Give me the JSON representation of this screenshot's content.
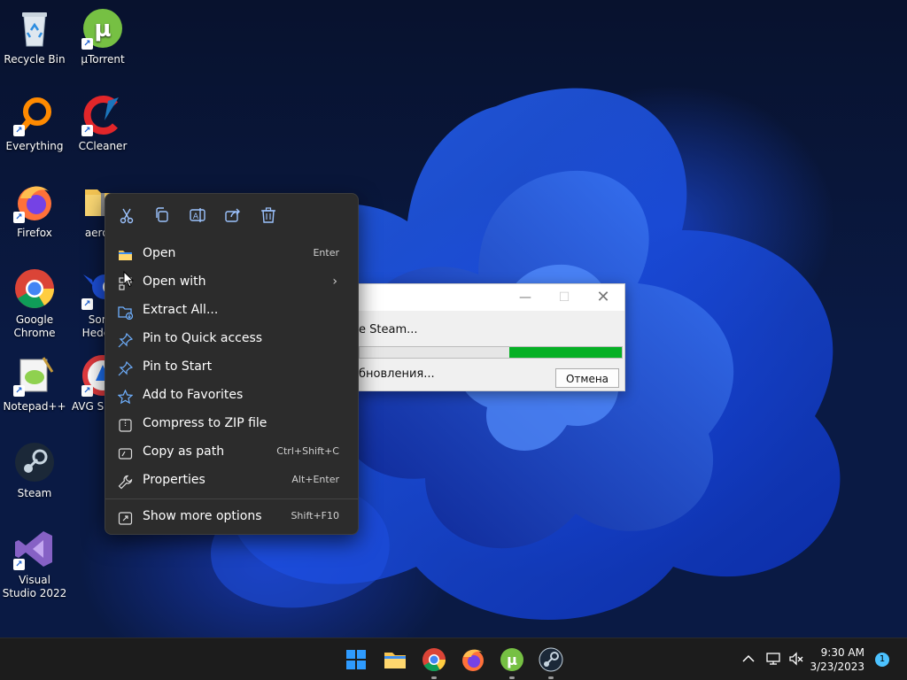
{
  "desktop": {
    "icons": [
      {
        "label": "Recycle Bin"
      },
      {
        "label": "µTorrent"
      },
      {
        "label": "Everything"
      },
      {
        "label": "CCleaner"
      },
      {
        "label": "Firefox"
      },
      {
        "label": "aero_h"
      },
      {
        "label": "Google Chrome"
      },
      {
        "label": "Sonic Hedgeh"
      },
      {
        "label": "Notepad++"
      },
      {
        "label": "AVG S Brow"
      },
      {
        "label": "Steam"
      },
      {
        "label": "Visual Studio 2022"
      }
    ]
  },
  "dialog": {
    "status1": "e Steam...",
    "status2": "бновления...",
    "cancel_label": "Отмена",
    "progress_percent": 43,
    "accent": "#06b025"
  },
  "context_menu": {
    "toolbar": {
      "cut_icon": "cut-icon",
      "copy_icon": "copy-icon",
      "rename_icon": "rename-icon",
      "share_icon": "share-icon",
      "delete_icon": "trash-icon"
    },
    "items": [
      {
        "label": "Open",
        "shortcut": "Enter"
      },
      {
        "label": "Open with",
        "shortcut": ""
      },
      {
        "label": "Extract All...",
        "shortcut": ""
      },
      {
        "label": "Pin to Quick access",
        "shortcut": ""
      },
      {
        "label": "Pin to Start",
        "shortcut": ""
      },
      {
        "label": "Add to Favorites",
        "shortcut": ""
      },
      {
        "label": "Compress to ZIP file",
        "shortcut": ""
      },
      {
        "label": "Copy as path",
        "shortcut": "Ctrl+Shift+C"
      },
      {
        "label": "Properties",
        "shortcut": "Alt+Enter"
      },
      {
        "label": "Show more options",
        "shortcut": "Shift+F10"
      }
    ]
  },
  "taskbar": {
    "apps": [
      "start-icon",
      "file-explorer-icon",
      "chrome-icon",
      "firefox-icon",
      "utorrent-icon",
      "steam-icon"
    ],
    "time": "9:30 AM",
    "date": "3/23/2023",
    "notification_count": "1"
  }
}
